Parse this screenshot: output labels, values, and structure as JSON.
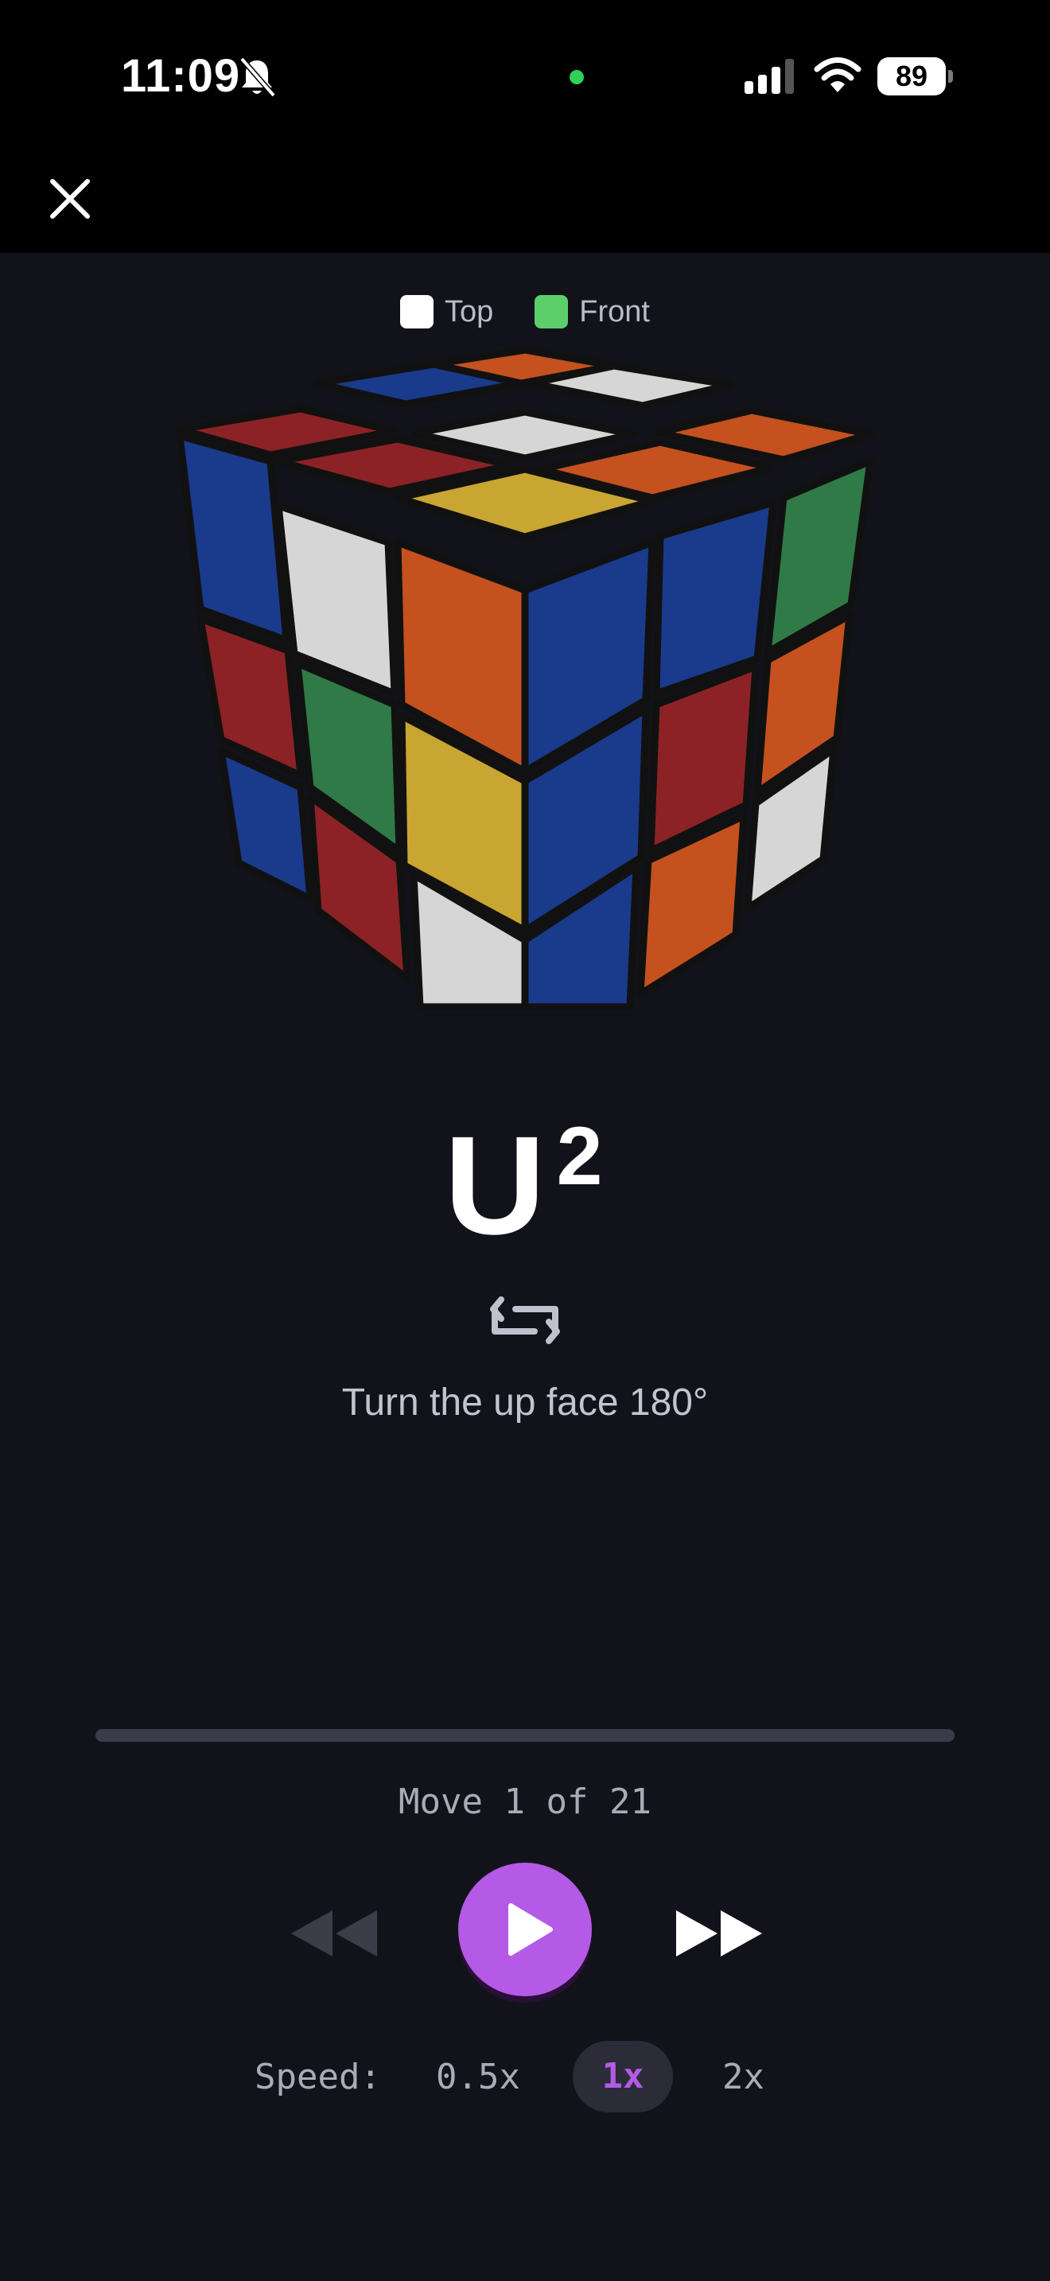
{
  "status_bar": {
    "time": "11:09",
    "battery": "89"
  },
  "legend": [
    {
      "label": "Top",
      "color": "#ffffff"
    },
    {
      "label": "Front",
      "color": "#5ccf6a"
    }
  ],
  "move": {
    "notation": "U",
    "modifier": "2",
    "description": "Turn the up face 180°"
  },
  "progress": {
    "current": 1,
    "total": 21,
    "fraction": 0.0,
    "label": "Move 1 of 21"
  },
  "controls": {
    "rewind_icon": "rewind-icon",
    "play_icon": "play-icon",
    "forward_icon": "fast-forward-icon"
  },
  "speed": {
    "label": "Speed:",
    "options": [
      "0.5x",
      "1x",
      "2x"
    ],
    "selected": "1x"
  },
  "colors": {
    "accent": "#b45ae6",
    "cube_red": "#8c2225",
    "cube_blue": "#1a3a8c",
    "cube_orange": "#c4511e",
    "cube_white": "#d6d6d6",
    "cube_green": "#2f7a46",
    "cube_yellow": "#c9a531"
  }
}
